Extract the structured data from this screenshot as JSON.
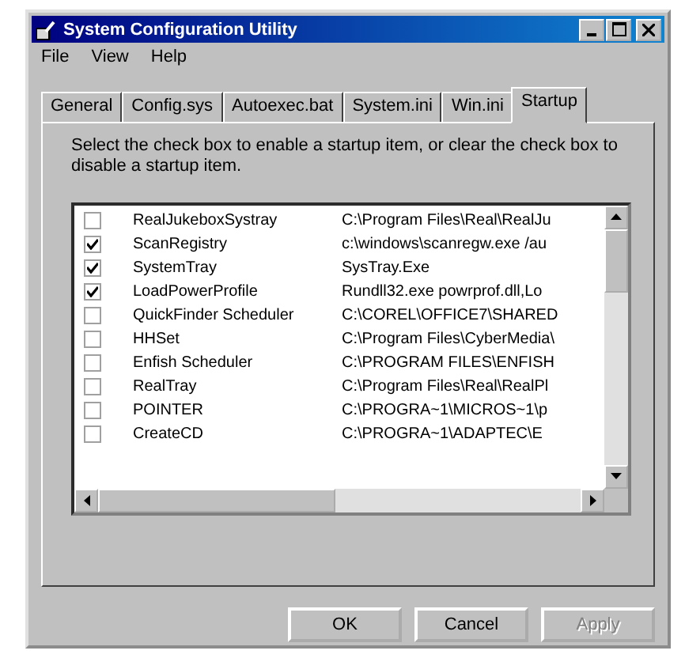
{
  "window": {
    "title": "System Configuration Utility"
  },
  "menu": [
    "File",
    "View",
    "Help"
  ],
  "tabs": [
    {
      "label": "General",
      "selected": false
    },
    {
      "label": "Config.sys",
      "selected": false
    },
    {
      "label": "Autoexec.bat",
      "selected": false
    },
    {
      "label": "System.ini",
      "selected": false
    },
    {
      "label": "Win.ini",
      "selected": false
    },
    {
      "label": "Startup",
      "selected": true
    }
  ],
  "instructions": "Select the check box to enable a startup item, or clear the check box to disable a startup item.",
  "startup_items": [
    {
      "name": "RealJukeboxSystray",
      "command": "C:\\Program Files\\Real\\RealJu",
      "checked": false
    },
    {
      "name": "ScanRegistry",
      "command": "c:\\windows\\scanregw.exe /au",
      "checked": true
    },
    {
      "name": "SystemTray",
      "command": "SysTray.Exe",
      "checked": true
    },
    {
      "name": "LoadPowerProfile",
      "command": "Rundll32.exe powrprof.dll,Lo",
      "checked": true
    },
    {
      "name": "QuickFinder Scheduler",
      "command": "C:\\COREL\\OFFICE7\\SHARED",
      "checked": false
    },
    {
      "name": "HHSet",
      "command": "C:\\Program Files\\CyberMedia\\",
      "checked": false
    },
    {
      "name": "Enfish Scheduler",
      "command": "C:\\PROGRAM FILES\\ENFISH",
      "checked": false
    },
    {
      "name": "RealTray",
      "command": "C:\\Program Files\\Real\\RealPl",
      "checked": false
    },
    {
      "name": "POINTER",
      "command": "C:\\PROGRA~1\\MICROS~1\\p",
      "checked": false
    },
    {
      "name": "CreateCD",
      "command": "C:\\PROGRA~1\\ADAPTEC\\E",
      "checked": false
    }
  ],
  "buttons": [
    {
      "label": "OK",
      "disabled": false
    },
    {
      "label": "Cancel",
      "disabled": false
    },
    {
      "label": "Apply",
      "disabled": true
    }
  ]
}
